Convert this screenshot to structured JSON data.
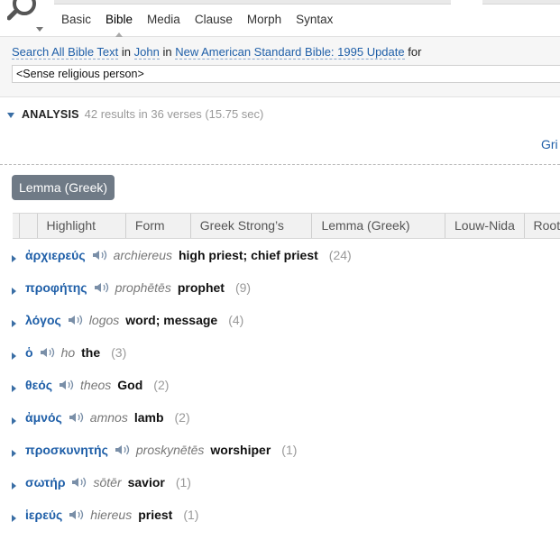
{
  "toolbar": {
    "tabs": [
      "Basic",
      "Bible",
      "Media",
      "Clause",
      "Morph",
      "Syntax"
    ],
    "active_tab": "Bible"
  },
  "query": {
    "prefix_link": "Search All Bible Text",
    "in1": "in",
    "book": "John",
    "in2": "in",
    "version": "New American Standard Bible: 1995 Update",
    "for": "for",
    "input_value": "<Sense religious person>"
  },
  "analysis": {
    "label": "ANALYSIS",
    "summary": "42 results in 36 verses (15.75 sec)",
    "grid_link": "Gri"
  },
  "group_button": "Lemma (Greek)",
  "columns": [
    "Highlight",
    "Form",
    "Greek Strong’s",
    "Lemma (Greek)",
    "Louw-Nida",
    "Root"
  ],
  "rows": [
    {
      "greek": "ἀρχιερεύς",
      "translit": "archiereus",
      "gloss": "high priest; chief priest",
      "count": "(24)"
    },
    {
      "greek": "προφήτης",
      "translit": "prophētēs",
      "gloss": "prophet",
      "count": "(9)"
    },
    {
      "greek": "λόγος",
      "translit": "logos",
      "gloss": "word; message",
      "count": "(4)"
    },
    {
      "greek": "ὁ",
      "translit": "ho",
      "gloss": "the",
      "count": "(3)"
    },
    {
      "greek": "θεός",
      "translit": "theos",
      "gloss": "God",
      "count": "(2)"
    },
    {
      "greek": "ἀμνός",
      "translit": "amnos",
      "gloss": "lamb",
      "count": "(2)"
    },
    {
      "greek": "προσκυνητής",
      "translit": "proskynētēs",
      "gloss": "worshiper",
      "count": "(1)"
    },
    {
      "greek": "σωτήρ",
      "translit": "sōtēr",
      "gloss": "savior",
      "count": "(1)"
    },
    {
      "greek": "ἱερεύς",
      "translit": "hiereus",
      "gloss": "priest",
      "count": "(1)"
    }
  ],
  "icons": {
    "search": "search-icon",
    "speaker": "speaker-icon",
    "expand": "expand-triangle-icon",
    "collapse": "collapse-triangle-icon"
  },
  "colors": {
    "link": "#1f5fa8",
    "group_button_bg": "#6f7a86",
    "muted": "#999999"
  }
}
